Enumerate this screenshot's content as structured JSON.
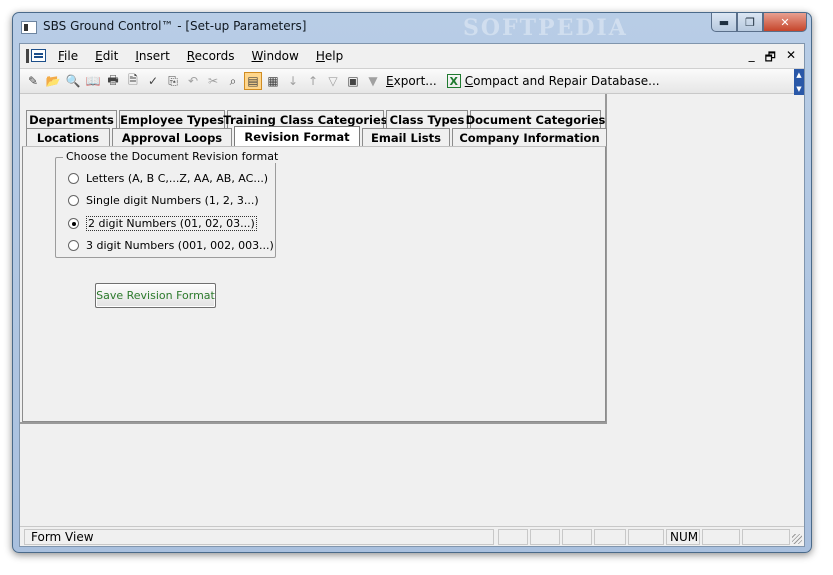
{
  "window": {
    "title": "SBS Ground Control™ - [Set-up Parameters]",
    "watermark": "SOFTPEDIA",
    "controls": {
      "minimize": "▬",
      "maximize": "❐",
      "close": "✕"
    }
  },
  "menubar": {
    "items": [
      {
        "label_u": "F",
        "label_rest": "ile"
      },
      {
        "label_u": "E",
        "label_rest": "dit"
      },
      {
        "label_u": "I",
        "label_rest": "nsert"
      },
      {
        "label_u": "R",
        "label_rest": "ecords"
      },
      {
        "label_u": "W",
        "label_rest": "indow"
      },
      {
        "label_u": "H",
        "label_rest": "elp"
      }
    ],
    "right_controls": {
      "minimize": "_",
      "restore": "🗗",
      "close": "✕"
    }
  },
  "toolbar": {
    "icons": [
      {
        "name": "design-view-icon",
        "glyph": "✎",
        "state": "normal"
      },
      {
        "name": "open-folder-icon",
        "glyph": "📂",
        "state": "normal"
      },
      {
        "name": "print-preview-icon",
        "glyph": "🔍",
        "state": "normal"
      },
      {
        "name": "book-icon",
        "glyph": "📖",
        "state": "normal"
      },
      {
        "name": "print-icon",
        "glyph": "🖶",
        "state": "normal"
      },
      {
        "name": "preview-icon",
        "glyph": "🗎",
        "state": "normal"
      },
      {
        "name": "spelling-icon",
        "glyph": "✓",
        "state": "normal"
      },
      {
        "name": "copy-icon",
        "glyph": "⎘",
        "state": "normal"
      },
      {
        "name": "undo-icon",
        "glyph": "↶",
        "state": "dim"
      },
      {
        "name": "cut-icon",
        "glyph": "✂",
        "state": "dim"
      },
      {
        "name": "find-icon",
        "glyph": "⌕",
        "state": "normal"
      },
      {
        "name": "form-view-icon",
        "glyph": "▤",
        "state": "active"
      },
      {
        "name": "datasheet-view-icon",
        "glyph": "▦",
        "state": "normal"
      },
      {
        "name": "sort-ascending-icon",
        "glyph": "↓",
        "state": "dim"
      },
      {
        "name": "sort-descending-icon",
        "glyph": "↑",
        "state": "dim"
      },
      {
        "name": "filter-by-selection-icon",
        "glyph": "▽",
        "state": "dim"
      },
      {
        "name": "filter-by-form-icon",
        "glyph": "▣",
        "state": "normal"
      },
      {
        "name": "apply-filter-icon",
        "glyph": "▼",
        "state": "dim"
      }
    ],
    "export_label_u": "E",
    "export_label_rest": "xport...",
    "excel_icon_glyph": "X",
    "compact_label_u": "C",
    "compact_label_rest": "ompact and Repair Database..."
  },
  "tabs": {
    "row1": [
      "Departments",
      "Employee Types",
      "Training Class Categories",
      "Class Types",
      "Document Categories"
    ],
    "row2": [
      "Locations",
      "Approval Loops",
      "Revision Format",
      "Email Lists",
      "Company Information"
    ],
    "selected": "Revision Format"
  },
  "revision_group": {
    "legend": "Choose the Document Revision format",
    "options": [
      {
        "label": "Letters (A, B C,...Z, AA, AB, AC...)",
        "checked": false
      },
      {
        "label": "Single digit Numbers (1, 2, 3...)",
        "checked": false
      },
      {
        "label": "2 digit Numbers (01, 02, 03...)",
        "checked": true
      },
      {
        "label": "3 digit Numbers (001, 002, 003...)",
        "checked": false
      }
    ]
  },
  "save_button": {
    "label": "Save Revision Format",
    "color": "#2c7a2c"
  },
  "statusbar": {
    "view": "Form View",
    "num": "NUM"
  }
}
